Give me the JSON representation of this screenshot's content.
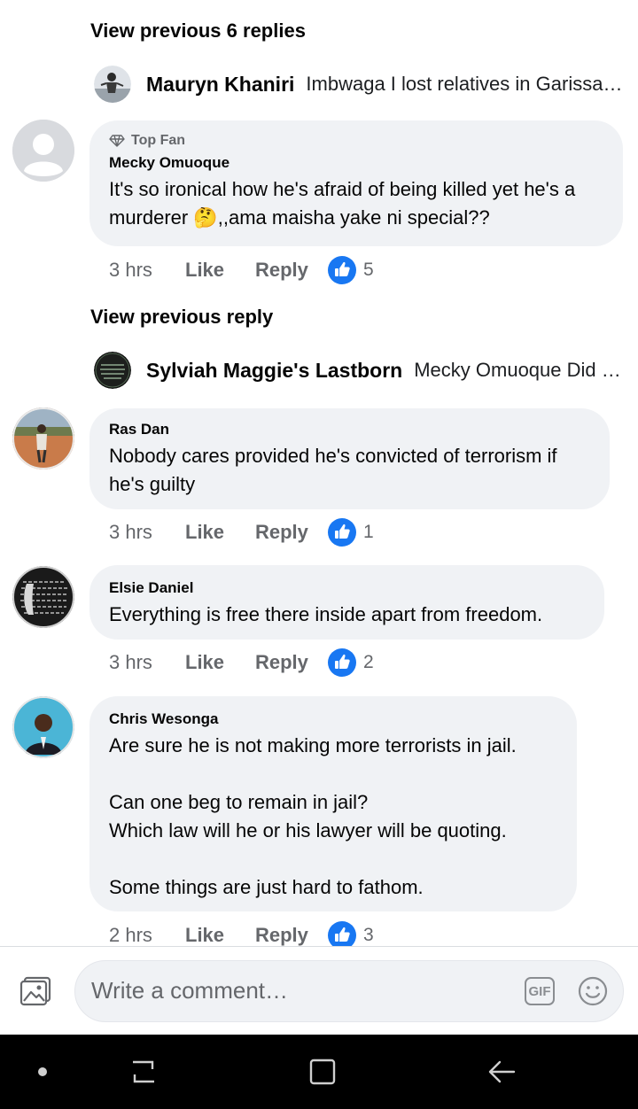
{
  "thread": {
    "view_previous_6": "View previous 6 replies",
    "view_previous_1": "View previous reply"
  },
  "reply_previews": [
    {
      "name": "Mauryn Khaniri",
      "text": "Imbwaga I lost relatives in Garissa university attack"
    },
    {
      "name": "Sylviah Maggie's Lastborn",
      "text": "Mecky Omuoque Did you read the whole story"
    }
  ],
  "comments": [
    {
      "badge": "Top Fan",
      "author": "Mecky Omuoque",
      "text": "It's so ironical how he's afraid of being killed yet he's a murderer 🤔,,ama maisha yake ni special??",
      "time": "3 hrs",
      "like": "Like",
      "reply": "Reply",
      "reactions": "5"
    },
    {
      "author": "Ras Dan",
      "text": "Nobody cares provided he's convicted of terrorism if he's guilty",
      "time": "3 hrs",
      "like": "Like",
      "reply": "Reply",
      "reactions": "1"
    },
    {
      "author": "Elsie Daniel",
      "text": "Everything is free there inside apart from freedom.",
      "time": "3 hrs",
      "like": "Like",
      "reply": "Reply",
      "reactions": "2"
    },
    {
      "author": "Chris Wesonga",
      "text": "Are sure he is not making more terrorists in jail.\n\nCan one beg to remain in jail?\nWhich law will he or his lawyer will be quoting.\n\nSome things are just hard to fathom.",
      "time": "2 hrs",
      "like": "Like",
      "reply": "Reply",
      "reactions": "3"
    }
  ],
  "composer": {
    "placeholder": "Write a comment…",
    "gif_label": "GIF"
  },
  "icons": {
    "photo": "photo-icon",
    "gif": "gif-icon",
    "emoji": "emoji-icon",
    "like_reaction": "like-reaction-icon",
    "top_fan": "diamond-icon"
  },
  "colors": {
    "like_blue": "#1877f2",
    "bubble_bg": "#f0f2f5",
    "muted_text": "#65676b"
  }
}
